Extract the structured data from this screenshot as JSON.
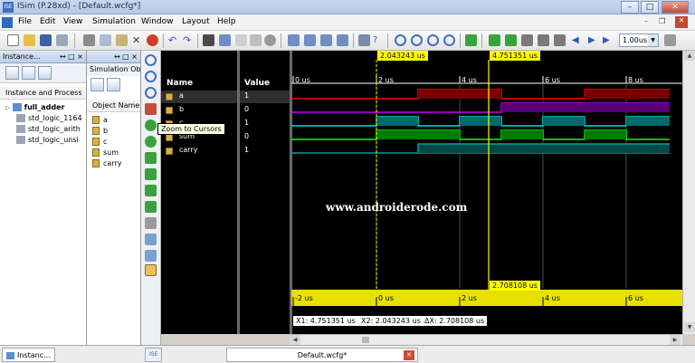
{
  "window": {
    "title": "ISim (P.28xd) - [Default.wcfg*]",
    "logo_text": "ISE",
    "min": "–",
    "max": "□",
    "close": "✕"
  },
  "menu": [
    "File",
    "Edit",
    "View",
    "Simulation",
    "Window",
    "Layout",
    "Help"
  ],
  "toolbar": {
    "time_value": "1.00us",
    "time_arrow": "▼"
  },
  "instance_pane": {
    "title": "Instance...",
    "header_ctrls": "↔ □ ×",
    "column_header": "Instance and Process",
    "items": [
      "full_adder",
      "std_logic_1164",
      "std_logic_arith",
      "std_logic_unsi"
    ]
  },
  "object_pane": {
    "title": "Simulation Ob...",
    "header_ctrls": "↔ □ ×",
    "column_header": "Object Name",
    "items": [
      "a",
      "b",
      "c",
      "sum",
      "carry"
    ]
  },
  "wave": {
    "name_header": "Name",
    "value_header": "Value",
    "signals": [
      {
        "name": "a",
        "value": "1",
        "color": "#ff0000"
      },
      {
        "name": "b",
        "value": "0",
        "color": "#c000ff"
      },
      {
        "name": "c",
        "value": "1",
        "color": "#00e0e0"
      },
      {
        "name": "sum",
        "value": "0",
        "color": "#00ff00"
      },
      {
        "name": "carry",
        "value": "1",
        "color": "#00a0a0"
      }
    ],
    "time_labels_top": [
      "0 us",
      "2 us",
      "4 us",
      "6 us",
      "8 us"
    ],
    "time_labels_bottom": [
      "-2 us",
      "0 us",
      "2 us",
      "4 us",
      "6 us"
    ],
    "cursor1_label": "2.043243 us",
    "cursor2_label": "4.751351 us",
    "delta_label": "2.708108 us",
    "readout": [
      "X1: 4.751351 us",
      "X2: 2.043243 us",
      "ΔX: 2.708108 us"
    ],
    "watermark": "www.androiderode.com"
  },
  "tooltip": "Zoom to Cursors",
  "bottom_tabs": {
    "instance": "Instanc...",
    "object_icon": "ISE",
    "file": "Default.wcfg*",
    "close": "✕"
  },
  "colors": {
    "cursor": "#ffff00",
    "grid": "#4a4a4a"
  }
}
